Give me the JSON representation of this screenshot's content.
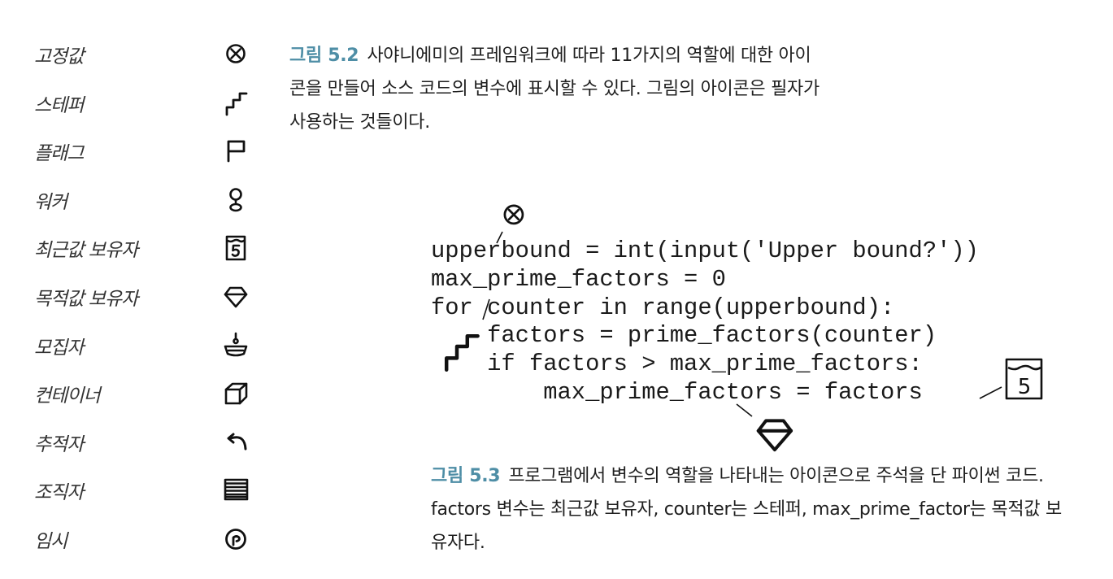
{
  "roles": [
    {
      "name": "고정값",
      "icon": "fixed-value-icon"
    },
    {
      "name": "스테퍼",
      "icon": "stepper-icon"
    },
    {
      "name": "플래그",
      "icon": "flag-icon"
    },
    {
      "name": "워커",
      "icon": "walker-icon"
    },
    {
      "name": "최근값 보유자",
      "icon": "most-recent-holder-icon"
    },
    {
      "name": "목적값 보유자",
      "icon": "most-wanted-holder-icon"
    },
    {
      "name": "모집자",
      "icon": "gatherer-icon"
    },
    {
      "name": "컨테이너",
      "icon": "container-icon"
    },
    {
      "name": "추적자",
      "icon": "follower-icon"
    },
    {
      "name": "조직자",
      "icon": "organizer-icon"
    },
    {
      "name": "임시",
      "icon": "temporary-icon"
    }
  ],
  "figure_5_2": {
    "label": "그림 5.2",
    "text": "사야니에미의 프레임워크에 따라 11가지의 역할에 대한 아이콘을 만들어 소스 코드의 변수에 표시할 수 있다. 그림의 아이콘은 필자가 사용하는 것들이다."
  },
  "code_lines": [
    "upperbound = int(input('Upper bound?'))",
    "max_prime_factors = 0",
    "for counter in range(upperbound):",
    "    factors = prime_factors(counter)",
    "    if factors > max_prime_factors:",
    "        max_prime_factors = factors"
  ],
  "annotations": {
    "most_recent_holder_value": "5"
  },
  "figure_5_3": {
    "label": "그림 5.3",
    "text": "프로그램에서 변수의 역할을 나타내는 아이콘으로 주석을 단 파이썬 코드. factors 변수는 최근값 보유자, counter는 스테퍼, max_prime_factor는 목적값 보유자다."
  }
}
